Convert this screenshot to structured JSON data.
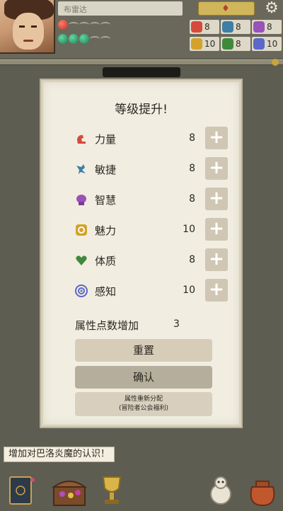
{
  "hud": {
    "name_placeholder": "布雷达",
    "stats": [
      {
        "icon": "strength-icon",
        "value": "8",
        "color": "#d64a3c"
      },
      {
        "icon": "agility-icon",
        "value": "8",
        "color": "#3d7fa6"
      },
      {
        "icon": "intelligence-icon",
        "value": "8",
        "color": "#9a52b8"
      },
      {
        "icon": "charisma-icon",
        "value": "10",
        "color": "#d4a22a"
      },
      {
        "icon": "constitution-icon",
        "value": "8",
        "color": "#3f8a3a"
      },
      {
        "icon": "perception-icon",
        "value": "10",
        "color": "#5a68c8"
      }
    ]
  },
  "panel": {
    "title": "等级提升!",
    "attributes": [
      {
        "icon": "strength-icon",
        "label": "力量",
        "value": "8",
        "color": "#d64a3c"
      },
      {
        "icon": "agility-icon",
        "label": "敏捷",
        "value": "8",
        "color": "#3d7fa6"
      },
      {
        "icon": "intelligence-icon",
        "label": "智慧",
        "value": "8",
        "color": "#9a52b8"
      },
      {
        "icon": "charisma-icon",
        "label": "魅力",
        "value": "10",
        "color": "#d4a22a"
      },
      {
        "icon": "constitution-icon",
        "label": "体质",
        "value": "8",
        "color": "#3f8a3a"
      },
      {
        "icon": "perception-icon",
        "label": "感知",
        "value": "10",
        "color": "#5a68c8"
      }
    ],
    "plus_label": "+",
    "points_label": "属性点数增加",
    "points_value": "3",
    "reset_label": "重置",
    "confirm_label": "确认",
    "redistribute_line1": "属性重新分配",
    "redistribute_line2": "(冒险者公会福利)"
  },
  "notice": "增加对巴洛炎魔的认识！",
  "bottom_bar": [
    "spellbook-icon",
    "treasure-chest-icon",
    "trophy-icon",
    "companion-icon",
    "bag-icon"
  ]
}
